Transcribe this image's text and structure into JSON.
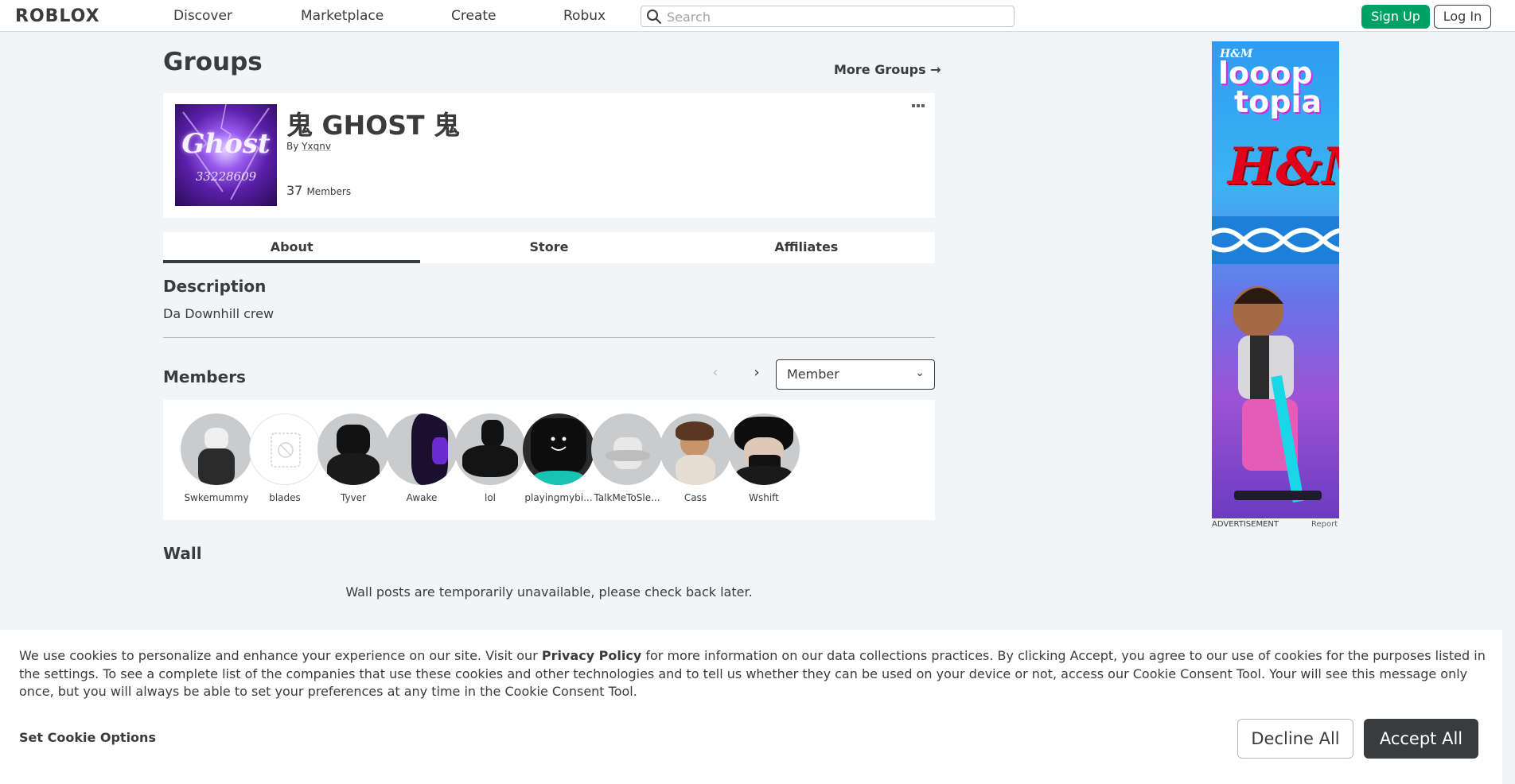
{
  "header": {
    "logo": "ROBLOX",
    "nav": [
      "Discover",
      "Marketplace",
      "Create",
      "Robux"
    ],
    "search_placeholder": "Search",
    "signup": "Sign Up",
    "login": "Log In"
  },
  "page": {
    "title": "Groups",
    "more_groups": "More Groups →"
  },
  "group": {
    "emblem_text": "Ghost",
    "emblem_number": "33228609",
    "name": "鬼 GHOST 鬼",
    "by_prefix": "By",
    "owner": "Yxqnv",
    "member_count": "37",
    "member_label": "Members",
    "menu_icon": "ellipsis-icon"
  },
  "tabs": [
    "About",
    "Store",
    "Affiliates"
  ],
  "active_tab": "About",
  "description": {
    "title": "Description",
    "text": "Da Downhill crew"
  },
  "members_section": {
    "title": "Members",
    "role_select": "Member",
    "members": [
      {
        "name": "Swkemummy"
      },
      {
        "name": "blades"
      },
      {
        "name": "Tyver"
      },
      {
        "name": "Awake"
      },
      {
        "name": "lol"
      },
      {
        "name": "playingmybi..."
      },
      {
        "name": "TalkMeToSle..."
      },
      {
        "name": "Cass"
      },
      {
        "name": "Wshift"
      }
    ]
  },
  "wall": {
    "title": "Wall",
    "message": "Wall posts are temporarily unavailable, please check back later."
  },
  "ad": {
    "brand_small": "H&M",
    "headline_1": "looop",
    "headline_2": "topia",
    "brand": "H&M",
    "label": "ADVERTISEMENT",
    "report": "Report"
  },
  "cookie": {
    "text_1": "We use cookies to personalize and enhance your experience on our site. Visit our ",
    "link": "Privacy Policy",
    "text_2": " for more information on our data collections practices. By clicking Accept, you agree to our use of cookies for the purposes listed in the settings. To see a complete list of the companies that use these cookies and other technologies and to tell us whether they can be used on your device or not, access our Cookie Consent Tool. Your will see this message only once, but you will always be able to set your preferences at any time in the Cookie Consent Tool.",
    "options": "Set Cookie Options",
    "decline": "Decline All",
    "accept": "Accept All"
  }
}
